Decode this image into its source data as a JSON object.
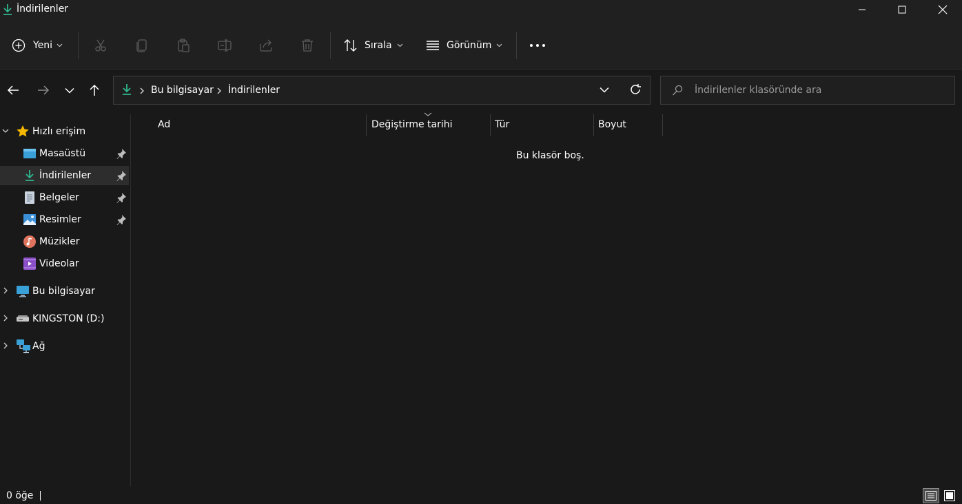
{
  "window": {
    "title": "İndirilenler"
  },
  "toolbar": {
    "new_label": "Yeni",
    "sort_label": "Sırala",
    "view_label": "Görünüm"
  },
  "address": {
    "segments": [
      "Bu bilgisayar",
      "İndirilenler"
    ]
  },
  "search": {
    "placeholder": "İndirilenler klasöründe ara"
  },
  "sidebar": {
    "quick_access": "Hızlı erişim",
    "items": [
      {
        "label": "Masaüstü",
        "icon": "desktop-icon",
        "pinned": true
      },
      {
        "label": "İndirilenler",
        "icon": "download-icon",
        "pinned": true,
        "selected": true
      },
      {
        "label": "Belgeler",
        "icon": "document-icon",
        "pinned": true
      },
      {
        "label": "Resimler",
        "icon": "pictures-icon",
        "pinned": true
      },
      {
        "label": "Müzikler",
        "icon": "music-icon",
        "pinned": false
      },
      {
        "label": "Videolar",
        "icon": "video-icon",
        "pinned": false
      }
    ],
    "this_pc": "Bu bilgisayar",
    "drive": "KINGSTON (D:)",
    "network": "Ağ"
  },
  "columns": [
    "Ad",
    "Değiştirme tarihi",
    "Tür",
    "Boyut"
  ],
  "content": {
    "empty_message": "Bu klasör boş."
  },
  "status": {
    "item_count": "0 öğe"
  },
  "colors": {
    "background": "#191919",
    "chrome": "#202020",
    "accent_download": "#2fb88f",
    "star": "#f5b800"
  }
}
